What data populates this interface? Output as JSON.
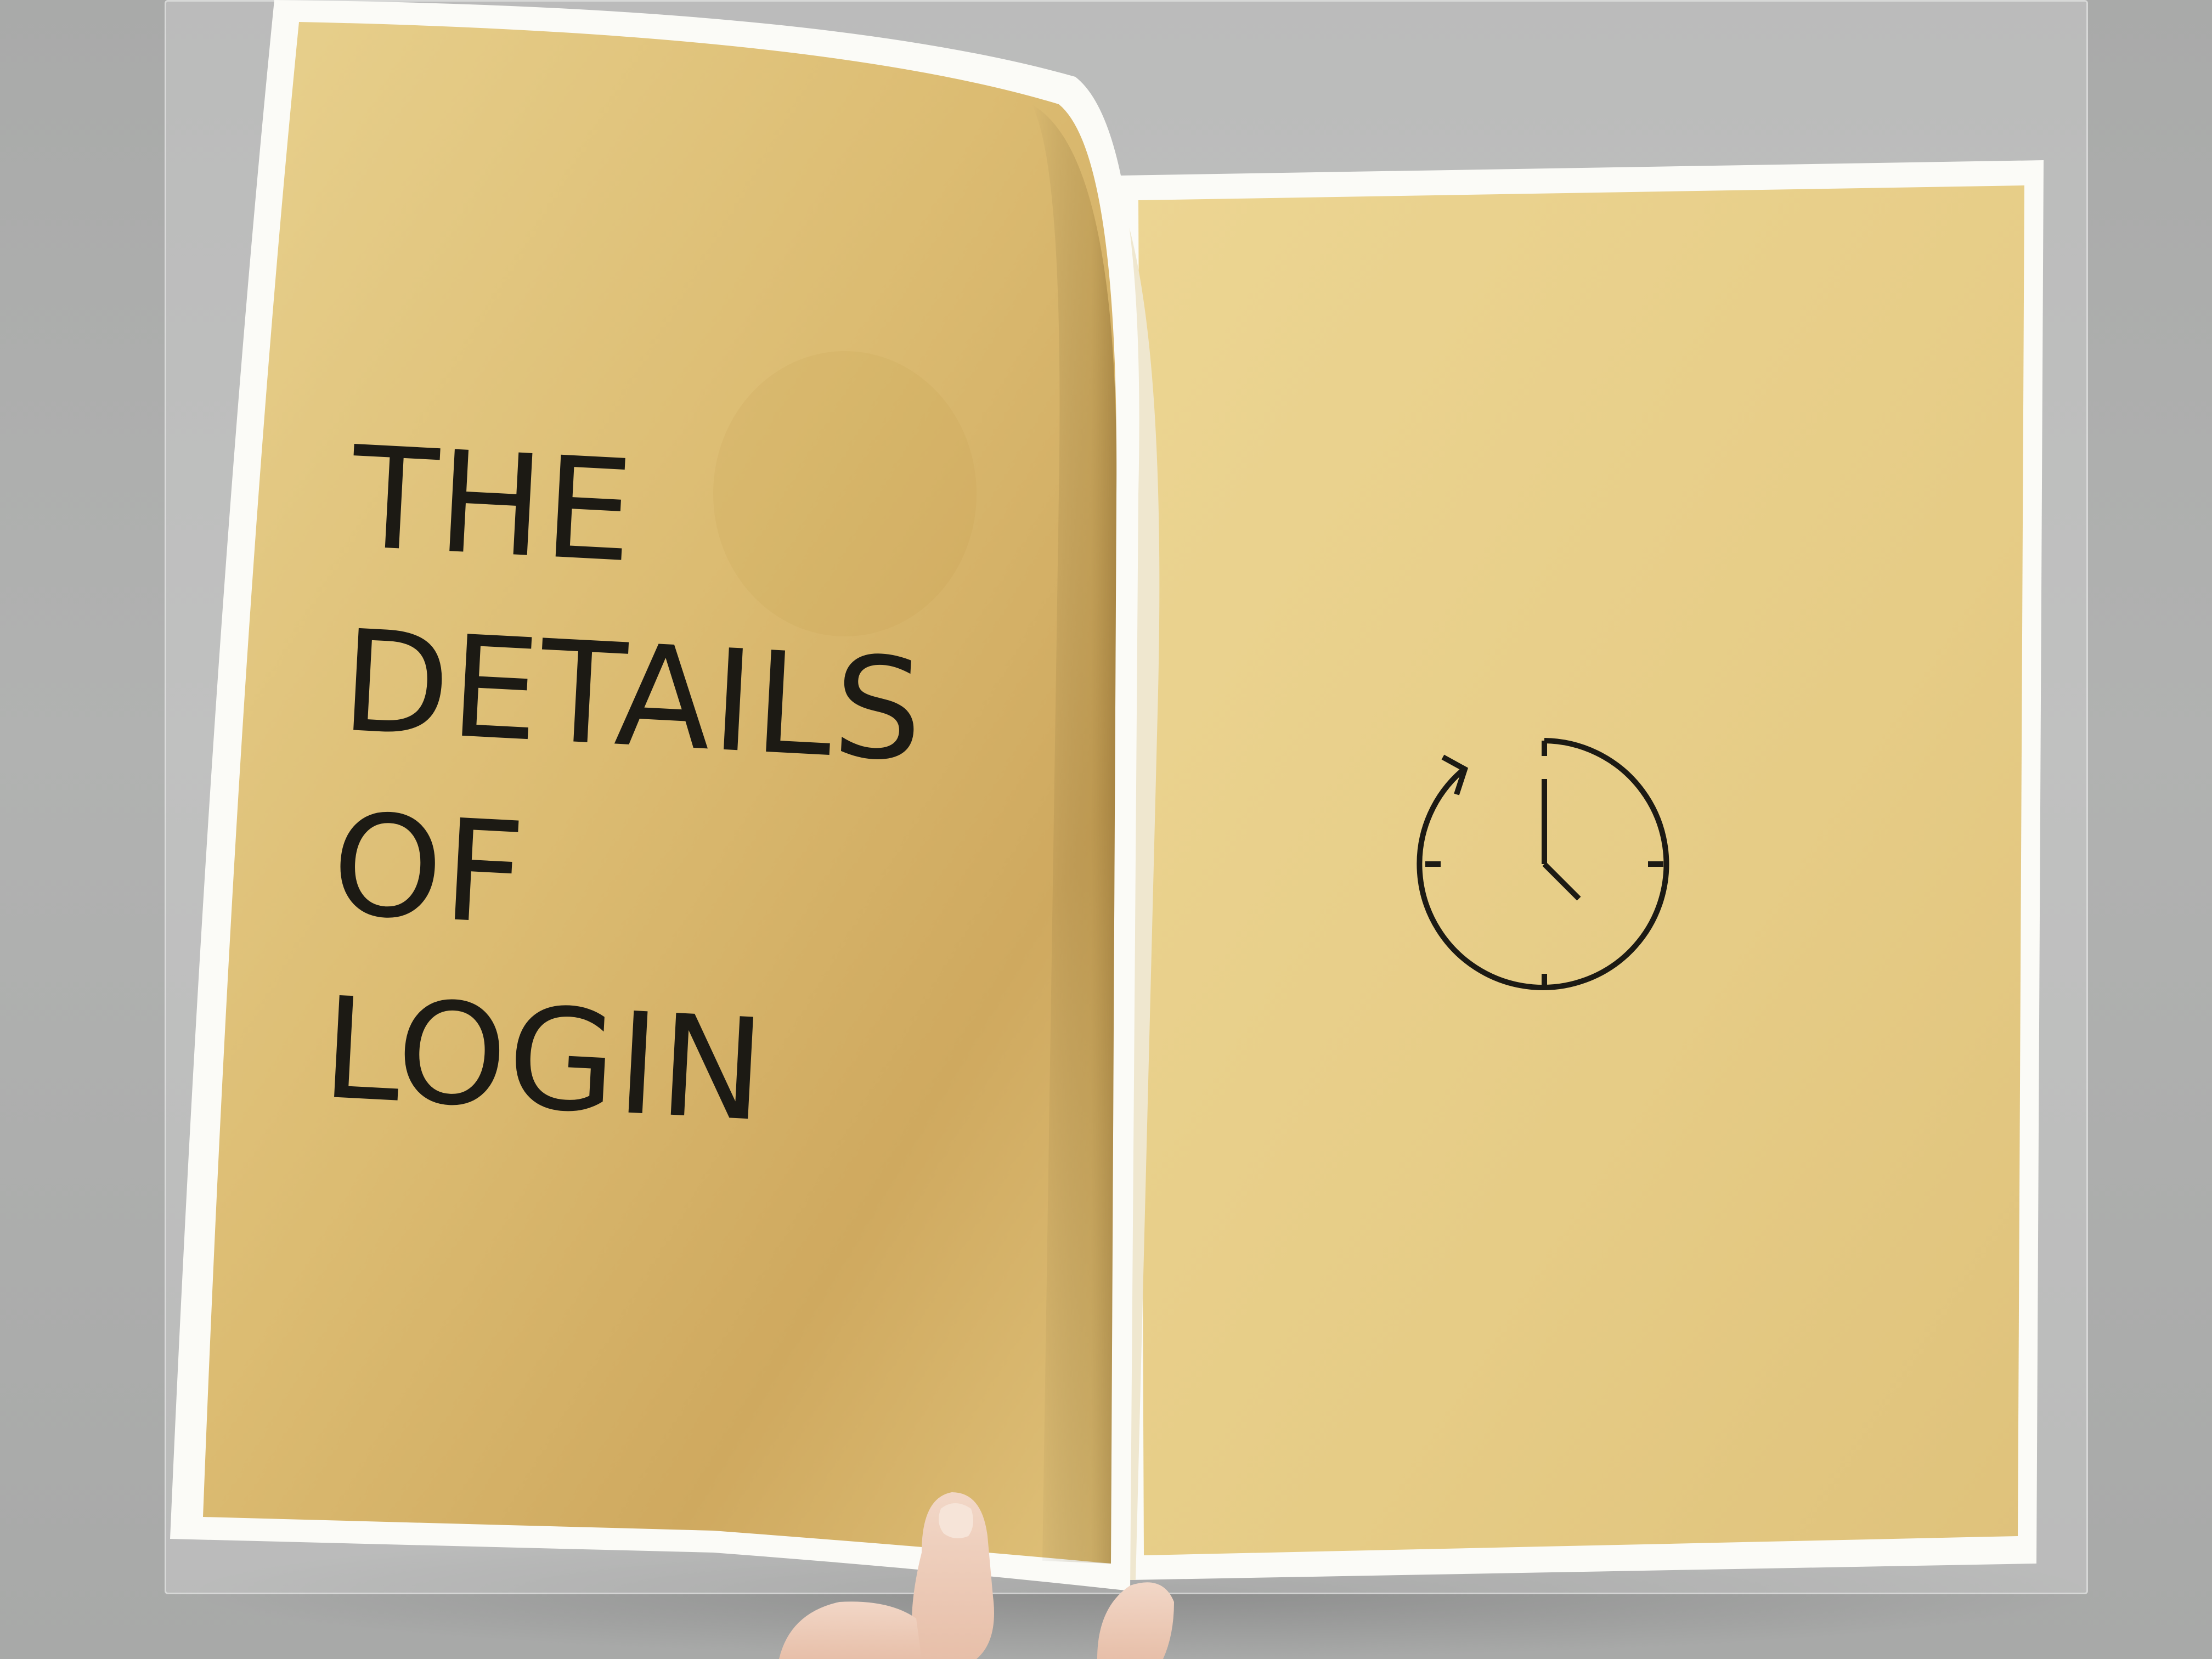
{
  "page": {
    "left_page_title": [
      "THE",
      "DETAILS",
      "OF",
      "LOGIN"
    ],
    "right_page_icon": "clock-refresh-icon"
  },
  "colors": {
    "wall": "#aeafae",
    "paper_yellow": "#e3c97f",
    "paper_border": "#fbfbf7",
    "ink": "#1c1a14"
  }
}
